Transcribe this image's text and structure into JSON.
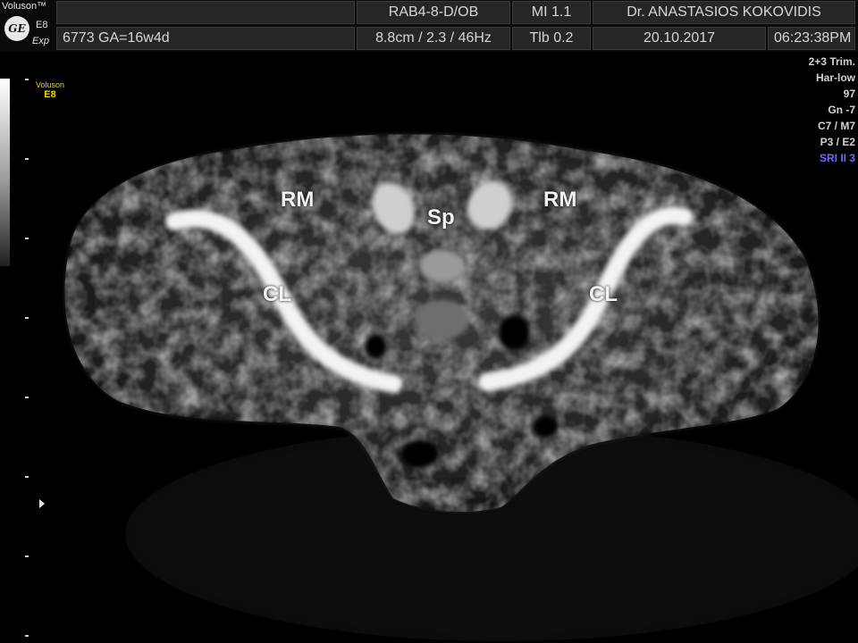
{
  "header": {
    "brand": {
      "name": "Voluson™",
      "logo_text": "GE",
      "model": "E8",
      "mode": "Exp"
    },
    "row1": {
      "unused": "",
      "probe": "RAB4-8-D/OB",
      "mi": "MI  1.1",
      "operator": "Dr. ANASTASIOS KOKOVIDIS"
    },
    "row2": {
      "patient": "6773  GA=16w4d",
      "depth": "8.8cm / 2.3 / 46Hz",
      "tib": "Tlb  0.2",
      "date": "20.10.2017",
      "time": "06:23:38PM"
    }
  },
  "sidebar": {
    "mini_logo": "Voluson",
    "mini_model": "E8"
  },
  "params": [
    {
      "text": "2+3 Trim.",
      "color": "#d2d2d2"
    },
    {
      "text": "Har-low",
      "color": "#d2d2d2"
    },
    {
      "text": "97",
      "color": "#d2d2d2"
    },
    {
      "text": "Gn  -7",
      "color": "#d2d2d2"
    },
    {
      "text": "C7 / M7",
      "color": "#d2d2d2"
    },
    {
      "text": "P3 / E2",
      "color": "#d2d2d2"
    },
    {
      "text": "SRI II 3",
      "color": "#6a6aff"
    }
  ],
  "image_labels": {
    "rm_left": "RM",
    "sp": "Sp",
    "rm_right": "RM",
    "cl_left": "CL",
    "cl_right": "CL"
  }
}
